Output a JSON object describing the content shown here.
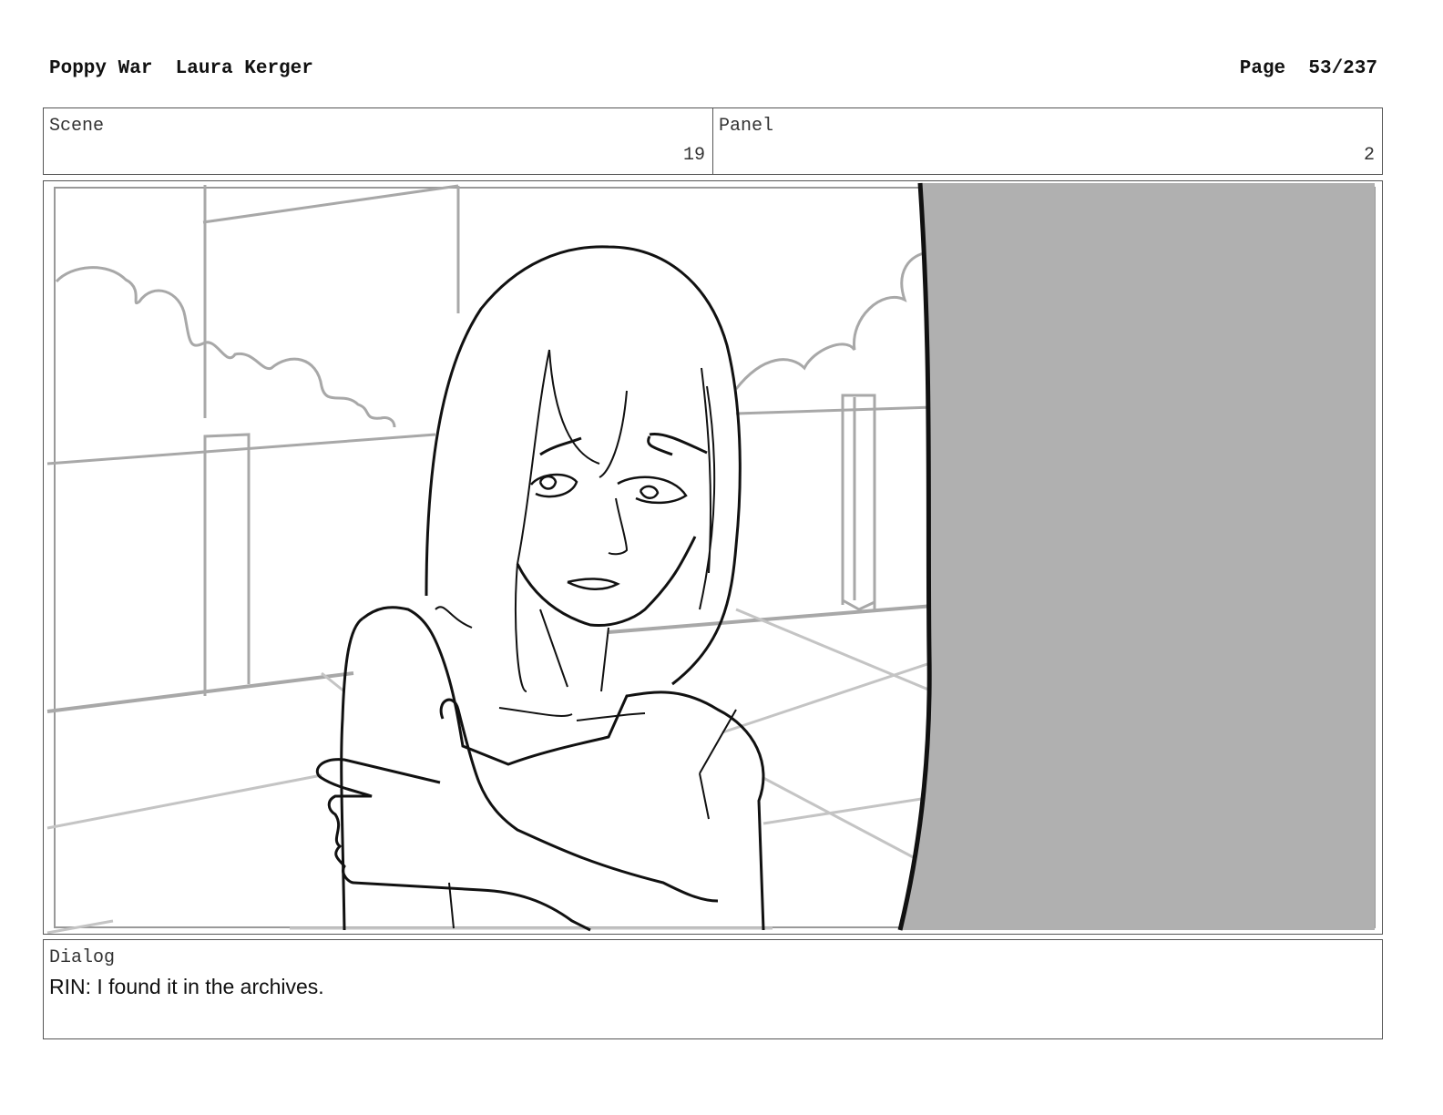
{
  "header": {
    "project": "Poppy War",
    "author": "Laura Kerger",
    "page_label": "Page",
    "page_value": "53/237"
  },
  "info": {
    "scene_label": "Scene",
    "scene_value": "19",
    "panel_label": "Panel",
    "panel_value": "2"
  },
  "dialog": {
    "label": "Dialog",
    "text": "RIN: I found it in the archives."
  },
  "colors": {
    "wall_gray": "#b0b0b0",
    "line_dark": "#111111",
    "line_light": "#a8a8a8"
  }
}
